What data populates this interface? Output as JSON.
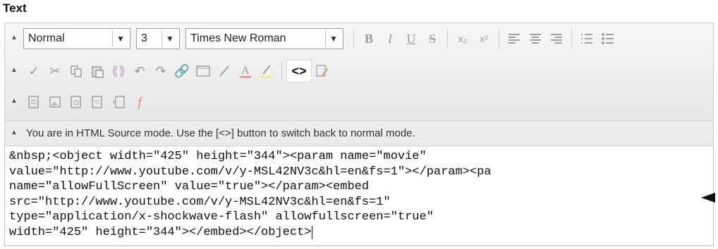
{
  "field_label": "Text",
  "toolbar": {
    "format_select": "Normal",
    "size_select": "3",
    "font_select": "Times New Roman"
  },
  "info_text": "You are in HTML Source mode. Use the [<>] button to switch back to normal mode.",
  "source_lines": [
    "&nbsp;<object width=\"425\" height=\"344\"><param name=\"movie\"",
    "value=\"http://www.youtube.com/v/y-MSL42NV3c&hl=en&fs=1\"></param><pa",
    "name=\"allowFullScreen\" value=\"true\"></param><embed",
    "src=\"http://www.youtube.com/v/y-MSL42NV3c&hl=en&fs=1\"",
    "type=\"application/x-shockwave-flash\" allowfullscreen=\"true\"",
    "width=\"425\" height=\"344\"></embed></object>"
  ],
  "icons": {
    "row1": [
      "bold-icon",
      "italic-icon",
      "underline-icon",
      "strikethrough-icon",
      "subscript-icon",
      "superscript-icon",
      "align-left-icon",
      "align-center-icon",
      "align-right-icon",
      "ordered-list-icon",
      "unordered-list-icon"
    ],
    "row2": [
      "spellcheck-icon",
      "cut-icon",
      "copy-icon",
      "paste-icon",
      "anchor-icon",
      "undo-icon",
      "redo-icon",
      "link-icon",
      "image-icon",
      "line-icon",
      "font-color-icon",
      "highlight-icon",
      "source-toggle-icon",
      "cleanup-icon"
    ],
    "row3": [
      "table-insert-icon",
      "image-insert-icon",
      "media-insert-icon",
      "template-icon",
      "plugin-icon",
      "flash-icon"
    ]
  },
  "colors": {
    "toolbar_bg": "#eeeeee",
    "border": "#cfcfcf",
    "arrow": "#111111"
  }
}
